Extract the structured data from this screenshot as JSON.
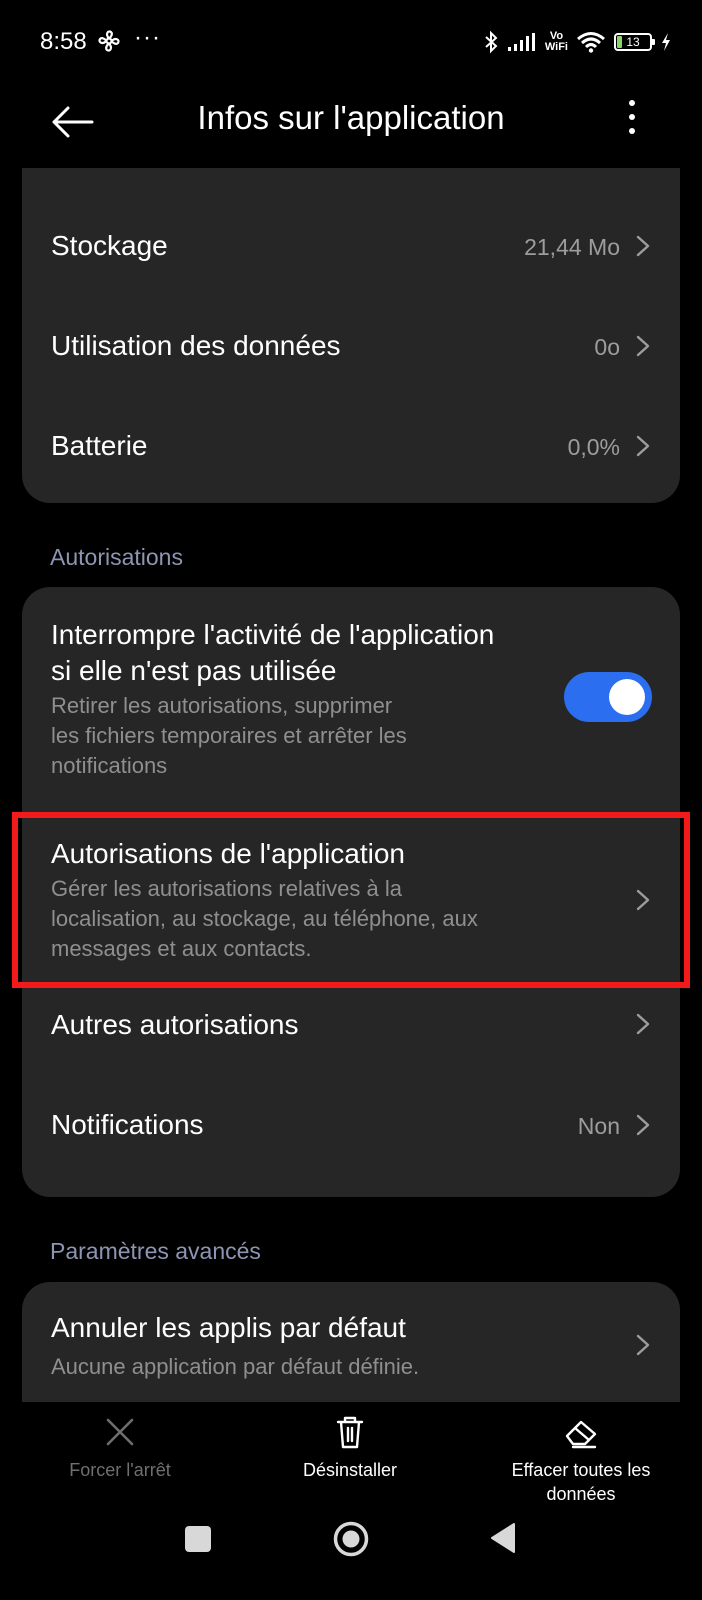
{
  "status_bar": {
    "time": "8:58",
    "dots": "···",
    "network_vo": "Vo",
    "network_wifi": "WiFi",
    "battery_level": "13"
  },
  "app_bar": {
    "title": "Infos sur l'application",
    "icons": [
      "back-arrow-icon",
      "more-vert-icon"
    ]
  },
  "usage": {
    "items": [
      {
        "label": "Stockage",
        "value": "21,44 Mo"
      },
      {
        "label": "Utilisation des données",
        "value": "0o"
      },
      {
        "label": "Batterie",
        "value": "0,0%"
      }
    ]
  },
  "permissions": {
    "section_title": "Autorisations",
    "pause_activity": {
      "title_line1": "Interrompre l'activité de l'application",
      "title_line2": "si elle n'est pas utilisée",
      "sub_line1": "Retirer les autorisations, supprimer",
      "sub_line2": "les fichiers temporaires et arrêter les",
      "sub_line3": "notifications",
      "enabled": true
    },
    "app_permissions": {
      "title": "Autorisations de l'application",
      "sub_line1": "Gérer les autorisations relatives à la",
      "sub_line2": "localisation, au stockage, au téléphone, aux",
      "sub_line3": "messages et aux contacts."
    },
    "other_permissions": {
      "label": "Autres autorisations"
    },
    "notifications": {
      "label": "Notifications",
      "value": "Non"
    }
  },
  "advanced": {
    "section_title": "Paramètres avancés",
    "default_apps": {
      "title": "Annuler les applis par défaut",
      "sub": "Aucune application par défaut définie."
    }
  },
  "bottom_actions": {
    "force_stop": "Forcer l'arrêt",
    "uninstall": "Désinstaller",
    "clear_line1": "Effacer toutes les",
    "clear_line2": "données"
  },
  "colors": {
    "background": "#000000",
    "card": "#262626",
    "accent_toggle": "#2b6ef0",
    "highlight_border": "#f21a1a",
    "section_title": "#8e95b2"
  }
}
